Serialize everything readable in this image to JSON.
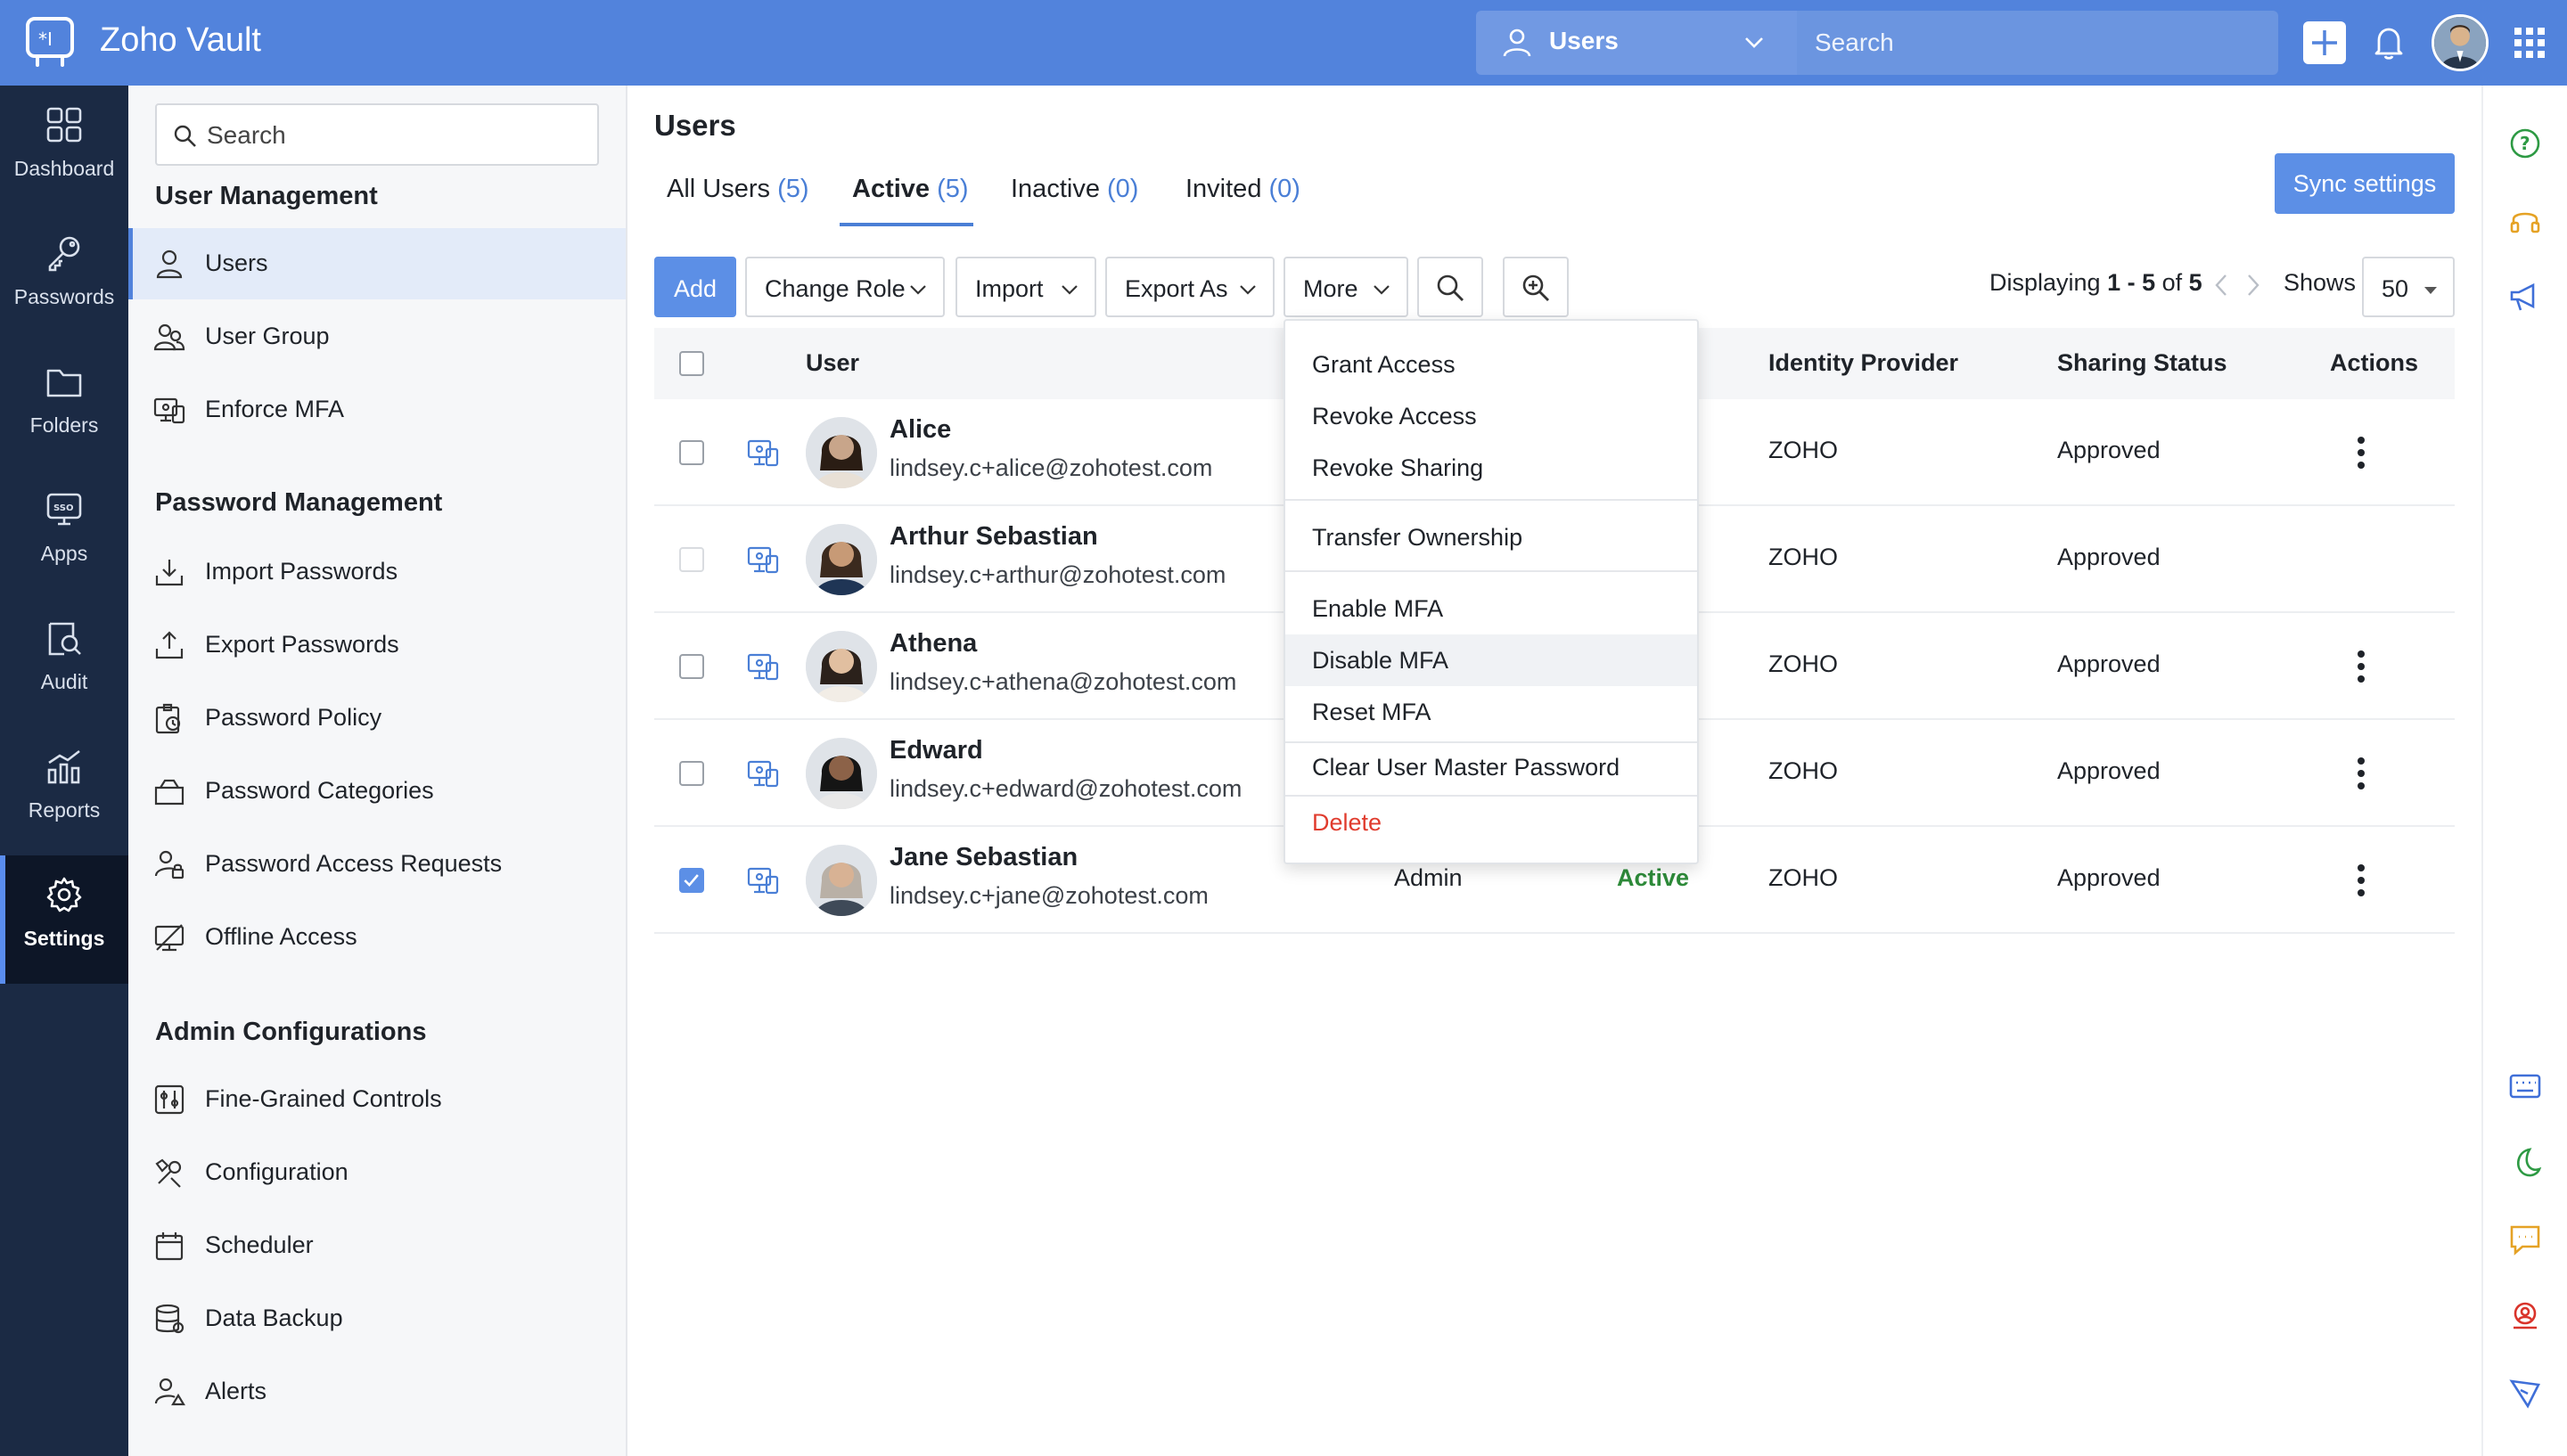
{
  "app": {
    "title": "Zoho Vault"
  },
  "topbar": {
    "scope_label": "Users",
    "search_placeholder": "Search"
  },
  "rail": [
    {
      "label": "Dashboard",
      "icon": "dashboard-icon"
    },
    {
      "label": "Passwords",
      "icon": "key-icon"
    },
    {
      "label": "Folders",
      "icon": "folder-icon"
    },
    {
      "label": "Apps",
      "icon": "sso-icon"
    },
    {
      "label": "Audit",
      "icon": "audit-icon"
    },
    {
      "label": "Reports",
      "icon": "reports-icon"
    },
    {
      "label": "Settings",
      "icon": "gear-icon",
      "active": true
    }
  ],
  "sidebar": {
    "search_placeholder": "Search",
    "sections": [
      {
        "heading": "User Management",
        "items": [
          {
            "label": "Users",
            "icon": "user-icon",
            "active": true
          },
          {
            "label": "User Group",
            "icon": "user-group-icon"
          },
          {
            "label": "Enforce MFA",
            "icon": "mfa-icon"
          }
        ]
      },
      {
        "heading": "Password Management",
        "items": [
          {
            "label": "Import Passwords",
            "icon": "import-icon"
          },
          {
            "label": "Export Passwords",
            "icon": "export-icon"
          },
          {
            "label": "Password Policy",
            "icon": "policy-icon"
          },
          {
            "label": "Password Categories",
            "icon": "category-icon"
          },
          {
            "label": "Password Access Requests",
            "icon": "access-request-icon"
          },
          {
            "label": "Offline Access",
            "icon": "offline-icon"
          }
        ]
      },
      {
        "heading": "Admin Configurations",
        "items": [
          {
            "label": "Fine-Grained Controls",
            "icon": "controls-icon"
          },
          {
            "label": "Configuration",
            "icon": "configuration-icon"
          },
          {
            "label": "Scheduler",
            "icon": "calendar-icon"
          },
          {
            "label": "Data Backup",
            "icon": "database-icon"
          },
          {
            "label": "Alerts",
            "icon": "alert-user-icon"
          }
        ]
      }
    ]
  },
  "main": {
    "title": "Users",
    "tabs": [
      {
        "label": "All Users",
        "count": "(5)"
      },
      {
        "label": "Active",
        "count": "(5)",
        "active": true
      },
      {
        "label": "Inactive",
        "count": "(0)"
      },
      {
        "label": "Invited",
        "count": "(0)"
      }
    ],
    "sync_label": "Sync settings",
    "toolbar": {
      "add": "Add",
      "change_role": "Change Role",
      "import": "Import",
      "export_as": "Export As",
      "more": "More"
    },
    "pagination": {
      "prefix": "Displaying",
      "range": "1 - 5",
      "of": "of",
      "total": "5",
      "shows_label": "Shows",
      "page_size": "50"
    },
    "columns": {
      "user": "User",
      "identity_provider": "Identity Provider",
      "sharing_status": "Sharing Status",
      "actions": "Actions"
    },
    "users": [
      {
        "name": "Alice",
        "email": "lindsey.c+alice@zohotest.com",
        "role": "",
        "status": "",
        "idp": "ZOHO",
        "sharing": "Approved",
        "checked": false,
        "disabled": false,
        "actions": true
      },
      {
        "name": "Arthur Sebastian",
        "email": "lindsey.c+arthur@zohotest.com",
        "role": "",
        "status": "",
        "idp": "ZOHO",
        "sharing": "Approved",
        "checked": false,
        "disabled": true,
        "actions": false
      },
      {
        "name": "Athena",
        "email": "lindsey.c+athena@zohotest.com",
        "role": "",
        "status": "",
        "idp": "ZOHO",
        "sharing": "Approved",
        "checked": false,
        "disabled": false,
        "actions": true
      },
      {
        "name": "Edward",
        "email": "lindsey.c+edward@zohotest.com",
        "role": "",
        "status": "",
        "idp": "ZOHO",
        "sharing": "Approved",
        "checked": false,
        "disabled": false,
        "actions": true
      },
      {
        "name": "Jane Sebastian",
        "email": "lindsey.c+jane@zohotest.com",
        "role": "Admin",
        "status": "Active",
        "idp": "ZOHO",
        "sharing": "Approved",
        "checked": true,
        "disabled": false,
        "actions": true
      }
    ],
    "more_menu": [
      "Grant Access",
      "Revoke Access",
      "Revoke Sharing",
      "Transfer Ownership",
      "Enable MFA",
      "Disable MFA",
      "Reset MFA",
      "Clear User Master Password",
      "Delete"
    ]
  },
  "colors": {
    "topbar": "#5283dc",
    "rail": "#1b2a44",
    "accent": "#4a7fd6",
    "active_status": "#2e8b3a",
    "danger": "#e03c2e"
  },
  "right_rail_icons": [
    "help-icon",
    "headset-icon",
    "announcement-icon",
    "keyboard-icon",
    "moon-icon",
    "chat-icon",
    "locate-icon",
    "feedback-icon"
  ]
}
